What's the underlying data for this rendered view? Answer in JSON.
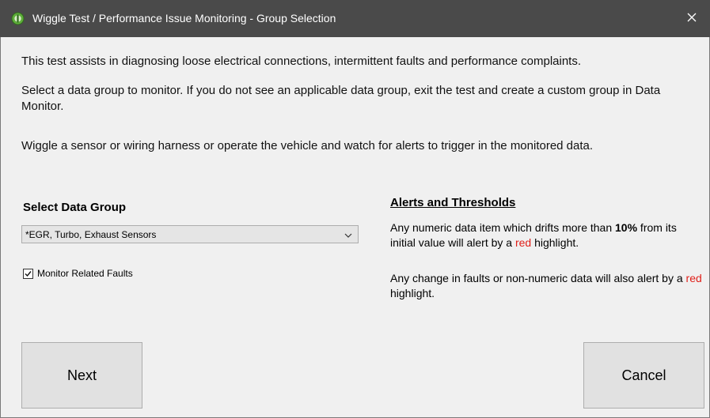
{
  "window": {
    "title": "Wiggle Test / Performance Issue Monitoring -  Group Selection",
    "app_icon": "green-gear-icon",
    "close_icon": "close-icon",
    "colors": {
      "titlebar": "#4a4a4a",
      "body": "#f0f0f0",
      "highlight_red": "#e0201a"
    }
  },
  "intro": {
    "line1": "This test assists in diagnosing loose electrical connections, intermittent faults and performance complaints.",
    "line2": "Select a data group to monitor. If you do not see an applicable data group, exit the test and create a custom group in Data Monitor.",
    "line3": "Wiggle a sensor or wiring harness or operate the vehicle and watch for alerts to trigger in the monitored data."
  },
  "data_group": {
    "heading": "Select Data Group",
    "selected_value": "*EGR, Turbo, Exhaust Sensors",
    "monitor_faults_label": "Monitor Related Faults",
    "monitor_faults_checked": true
  },
  "alerts": {
    "heading": "Alerts and Thresholds",
    "rule1_part1": "Any numeric data item which drifts more than ",
    "rule1_threshold": "10%",
    "rule1_part2": " from its initial value will alert by a ",
    "rule1_red": "red",
    "rule1_part3": " highlight.",
    "rule2_part1": "Any change in faults or non-numeric data will also alert by a ",
    "rule2_red": "red",
    "rule2_part2": " highlight."
  },
  "buttons": {
    "next_label": "Next",
    "cancel_label": "Cancel"
  }
}
